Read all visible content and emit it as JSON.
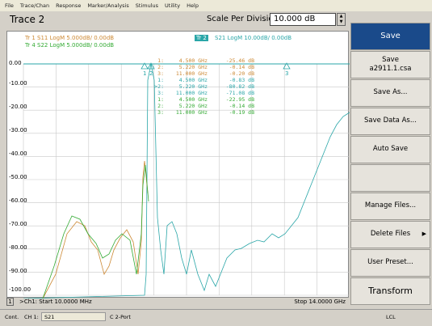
{
  "menu": [
    "File",
    "Trace/Chan",
    "Response",
    "Marker/Analysis",
    "Stimulus",
    "Utility",
    "Help"
  ],
  "header": {
    "trace_title": "Trace 2",
    "scale_label": "Scale Per Division",
    "scale_value": "10.000 dB"
  },
  "traces": {
    "tr1": "Tr 1  S11 LogM 5.000dB/ 0.00dB",
    "tr4": "Tr 4  S22 LogM 5.000dB/ 0.00dB",
    "tr2_badge": "Tr 2",
    "tr2": "S21 LogM 10.00dB/ 0.00dB"
  },
  "colors": {
    "tr1": "#cc8833",
    "tr4": "#33aa33",
    "tr2": "#2aa6a8",
    "softkey_active": "#1a4a8a"
  },
  "y_axis": [
    "0.00",
    "-10.00",
    "-20.00",
    "-30.00",
    "-40.00",
    "-50.00",
    "-60.00",
    "-70.00",
    "-80.00",
    "-90.00",
    "-100.00"
  ],
  "markers": [
    {
      "idx": "1:",
      "freq": "4.500 GHz",
      "val": "-25.46 dB",
      "color": "#cc8833"
    },
    {
      "idx": "2:",
      "freq": "5.220 GHz",
      "val": "-0.14 dB",
      "color": "#cc8833"
    },
    {
      "idx": "3:",
      "freq": "11.000 GHz",
      "val": "-0.20 dB",
      "color": "#cc8833"
    },
    {
      "idx": "1:",
      "freq": "4.500 GHz",
      "val": "-0.83 dB",
      "color": "#2aa6a8"
    },
    {
      "idx": ">2:",
      "freq": "5.220 GHz",
      "val": "-80.82 dB",
      "color": "#2aa6a8"
    },
    {
      "idx": "3:",
      "freq": "11.000 GHz",
      "val": "-71.08 dB",
      "color": "#2aa6a8"
    },
    {
      "idx": "1:",
      "freq": "4.500 GHz",
      "val": "-22.95 dB",
      "color": "#33aa33"
    },
    {
      "idx": "2:",
      "freq": "5.220 GHz",
      "val": "-0.14 dB",
      "color": "#33aa33"
    },
    {
      "idx": "3:",
      "freq": "11.000 GHz",
      "val": "-0.19 dB",
      "color": "#33aa33"
    }
  ],
  "marker_labels": [
    "1",
    "2",
    "3"
  ],
  "stimulus": {
    "channel_number": "1",
    "start": ">Ch1: Start  10.0000 MHz",
    "stop": "Stop  14.0000 GHz"
  },
  "softkeys": [
    {
      "label": "Save",
      "active": true,
      "arrow": false
    },
    {
      "label": "Save\na2911.1.csa",
      "active": false,
      "arrow": false
    },
    {
      "label": "Save As...",
      "active": false,
      "arrow": false
    },
    {
      "label": "Save Data As...",
      "active": false,
      "arrow": false
    },
    {
      "label": "Auto Save",
      "active": false,
      "arrow": false
    },
    {
      "label": "",
      "active": false,
      "arrow": false
    },
    {
      "label": "Manage Files...",
      "active": false,
      "arrow": false
    },
    {
      "label": "Delete Files",
      "active": false,
      "arrow": true
    },
    {
      "label": "User Preset...",
      "active": false,
      "arrow": false
    },
    {
      "label": "Transform",
      "active": false,
      "arrow": false
    }
  ],
  "status": {
    "mode": "Cont.",
    "channel": "CH 1:",
    "param": "S21",
    "port": "C  2-Port",
    "remote": "LCL"
  }
}
